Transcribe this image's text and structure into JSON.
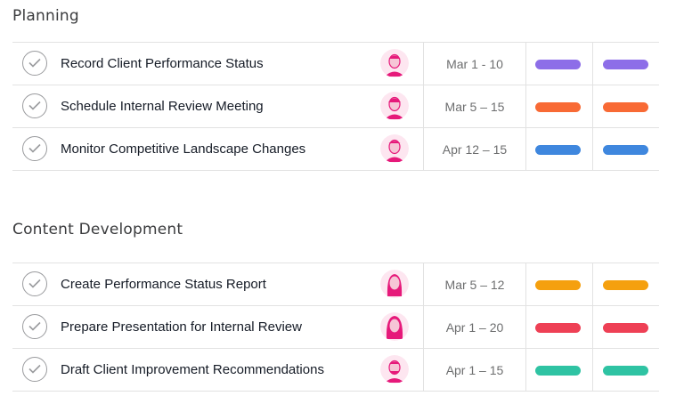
{
  "sections": [
    {
      "title": "Planning",
      "tasks": [
        {
          "name": "Record Client Performance Status",
          "date": "Mar 1 - 10",
          "color": "#8d6ee8"
        },
        {
          "name": "Schedule Internal Review Meeting",
          "date": "Mar 5 – 15",
          "color": "#f86a35"
        },
        {
          "name": "Monitor Competitive Landscape Changes",
          "date": "Apr 12 – 15",
          "color": "#3f87de"
        }
      ]
    },
    {
      "title": "Content Development",
      "tasks": [
        {
          "name": "Create Performance Status Report",
          "date": "Mar 5 – 12",
          "color": "#f5a00f"
        },
        {
          "name": "Prepare Presentation for Internal Review",
          "date": "Apr 1 – 20",
          "color": "#ee4055"
        },
        {
          "name": "Draft Client Improvement Recommendations",
          "date": "Apr 1 – 15",
          "color": "#2fc3a3"
        }
      ]
    }
  ],
  "icons": {
    "complete": "check-circle-icon",
    "assignee": "avatar-icon"
  },
  "colors": {
    "avatar_tint": "#e6197a",
    "border": "#e2e2e2",
    "check": "#9a9b9e"
  }
}
